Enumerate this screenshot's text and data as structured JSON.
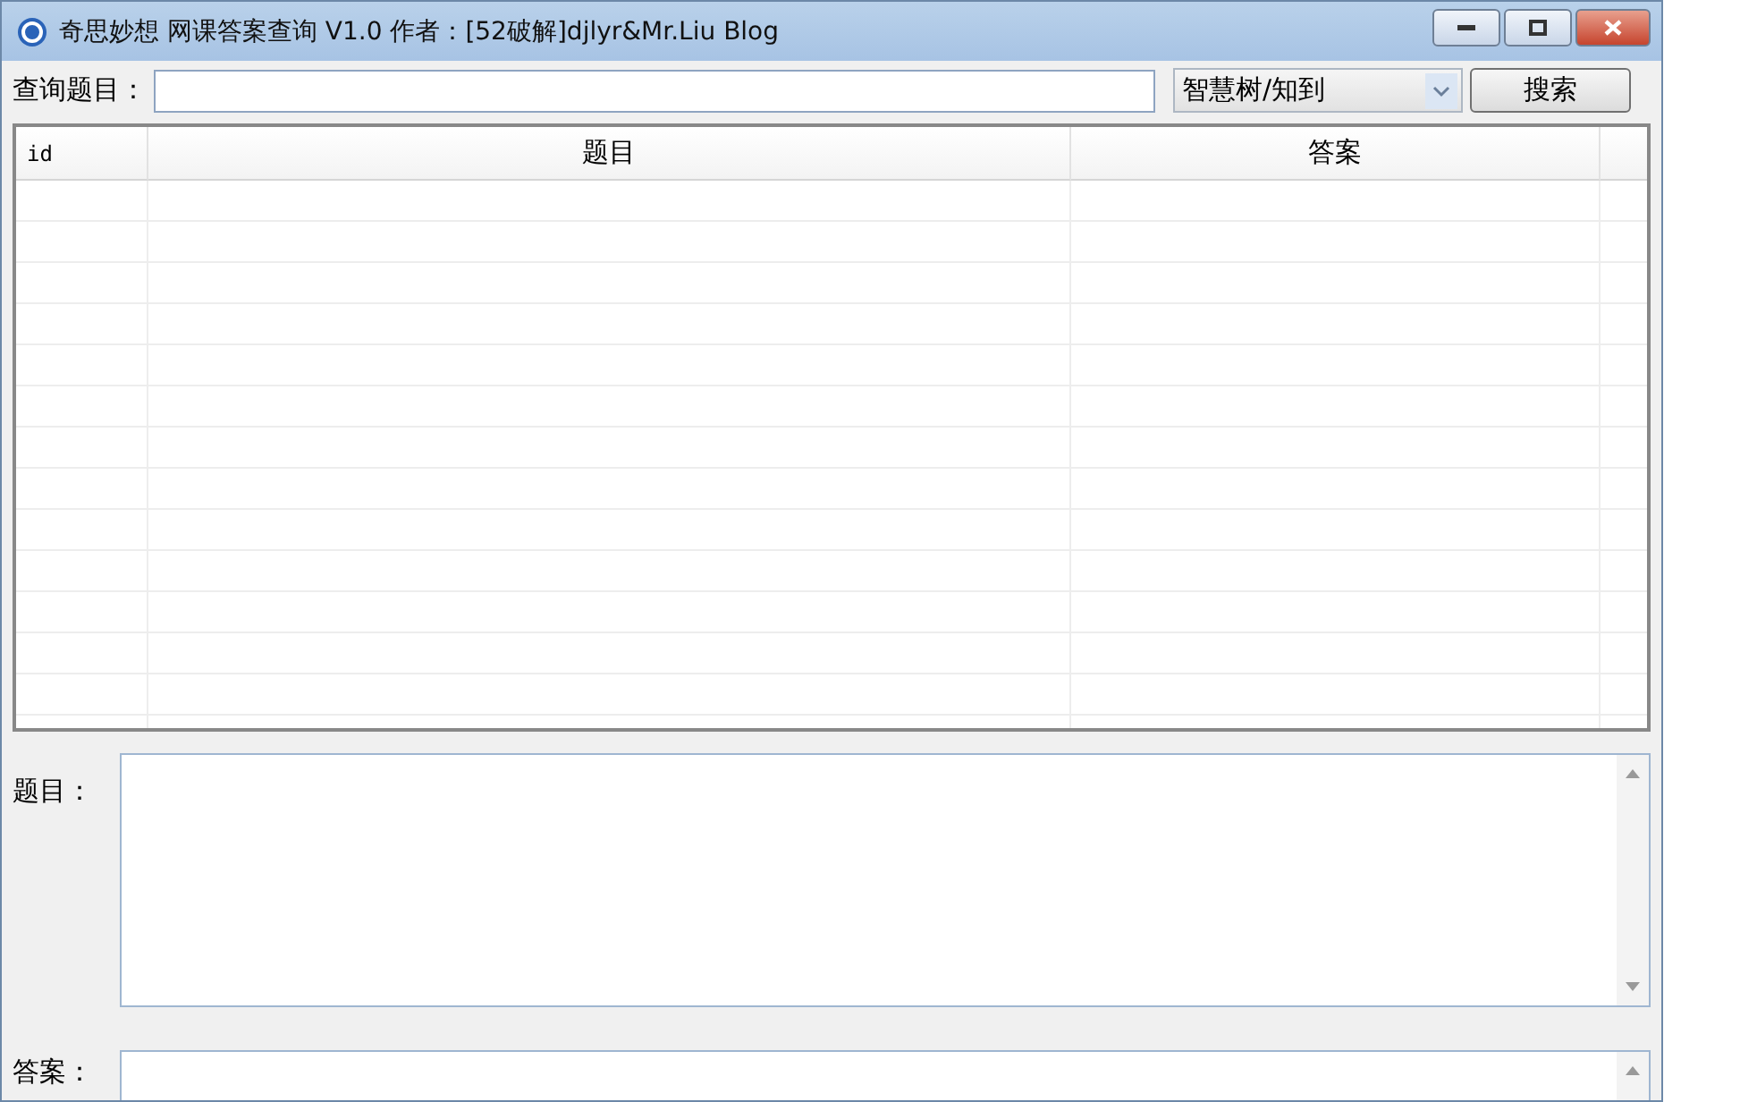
{
  "window": {
    "title": "奇思妙想 网课答案查询 V1.0 作者：[52破解]djlyr&Mr.Liu Blog"
  },
  "search": {
    "label": "查询题目：",
    "source": "智慧树/知到",
    "button": "搜索"
  },
  "table": {
    "columns": [
      "id",
      "题目",
      "答案"
    ]
  },
  "details": [
    {
      "label": "题目："
    },
    {
      "label": "答案："
    }
  ]
}
